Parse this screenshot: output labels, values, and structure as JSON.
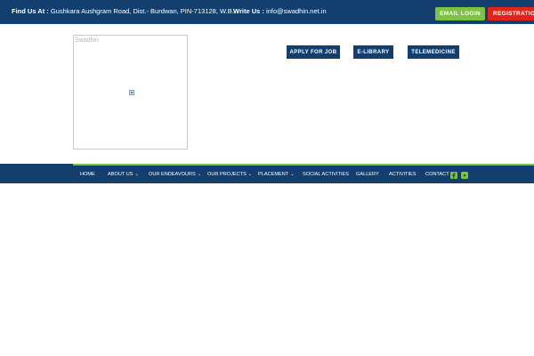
{
  "topbar": {
    "find_label": "Find Us At :",
    "find_value": "Gushkara Aushgram Road, Dist.- Burdwan, PIN-713128, W.B.",
    "write_label": "Write Us :",
    "write_value": "info@swadhin.net.in",
    "login_label": "EMAIL LOGIN",
    "register_label": "REGISTRATION"
  },
  "logo": {
    "alt_text": "Swadhin"
  },
  "actions": {
    "apply_label": "APPLY FOR JOB",
    "library_label": "E-LIBRARY",
    "telemedicine_label": "TELEMEDICINE"
  },
  "nav": {
    "items": [
      {
        "label": "HOME"
      },
      {
        "label": "ABOUT US"
      },
      {
        "label": "OUR ENDEAVOURS"
      },
      {
        "label": "OUR PROJECTS"
      },
      {
        "label": "PLACEMENT"
      },
      {
        "label": "SOCIAL ACTIVITIES"
      },
      {
        "label": "GALLERY"
      },
      {
        "label": "ACTIVITIES"
      },
      {
        "label": "CONTACT"
      }
    ],
    "social": [
      "facebook-icon",
      "youtube-icon"
    ]
  },
  "colors": {
    "primary": "#123f6e",
    "accent_green": "#7dc242",
    "accent_red": "#e2231a"
  }
}
